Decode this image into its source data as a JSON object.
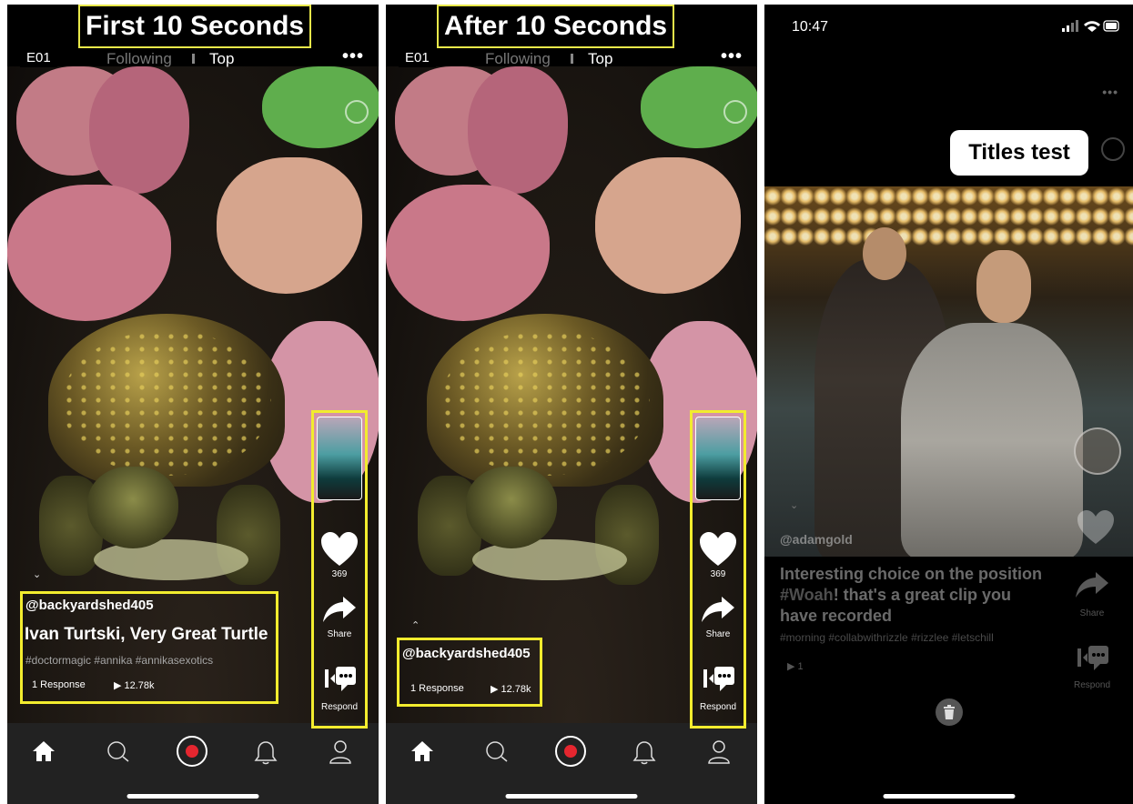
{
  "panel1": {
    "heading": "First 10 Seconds",
    "episode_badge": "E01",
    "tab_following": "Following",
    "tab_top": "Top",
    "username": "@backyardshed405",
    "video_title": "Ivan Turtski, Very Great Turtle",
    "hashtags": "#doctormagic #annika #annikasexotics",
    "responses": "1 Response",
    "views": "▶ 12.78k",
    "likes": "369",
    "share_label": "Share",
    "respond_label": "Respond"
  },
  "panel2": {
    "heading": "After 10 Seconds",
    "episode_badge": "E01",
    "tab_following": "Following",
    "tab_top": "Top",
    "username": "@backyardshed405",
    "responses": "1 Response",
    "views": "▶ 12.78k",
    "likes": "369",
    "share_label": "Share",
    "respond_label": "Respond"
  },
  "panel3": {
    "status_time": "10:47",
    "titles_bubble": "Titles test",
    "username": "@adamgold",
    "caption_plain1": "Interesting choice on the position ",
    "caption_hashtag": "#Woah",
    "caption_plain2": "! that's a great clip you have recorded",
    "hashtags": "#morning #collabwithrizzle #rizzlee #letschill",
    "views": "▶ 1",
    "share_label": "Share",
    "respond_label": "Respond"
  },
  "colors": {
    "highlight": "#f2ec2e",
    "record_red": "#e5262f"
  },
  "icons": [
    "home-icon",
    "search-icon",
    "record-icon",
    "bell-icon",
    "profile-icon",
    "heart-icon",
    "share-icon",
    "respond-icon",
    "trash-icon"
  ]
}
